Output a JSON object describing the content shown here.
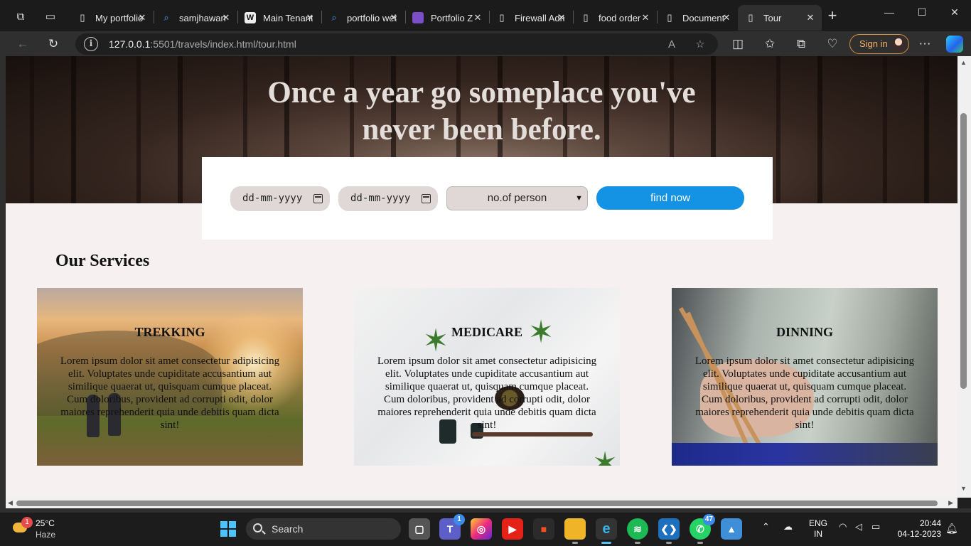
{
  "browser": {
    "tabs": [
      {
        "title": "My portfolio",
        "icon": "page-icon",
        "active": false
      },
      {
        "title": "samjhawan",
        "icon": "search-icon",
        "active": false
      },
      {
        "title": "Main Tenant",
        "icon": "logo-icon",
        "active": false
      },
      {
        "title": "portfolio website",
        "icon": "search-icon",
        "active": false
      },
      {
        "title": "Portfolio Z",
        "icon": "coloris-icon",
        "active": false
      },
      {
        "title": "Firewall Admin",
        "icon": "page-icon",
        "active": false
      },
      {
        "title": "food order",
        "icon": "page-icon",
        "active": false
      },
      {
        "title": "Document",
        "icon": "page-icon",
        "active": false
      },
      {
        "title": "Tour",
        "icon": "page-icon",
        "active": true
      }
    ],
    "address": {
      "host": "127.0.0.1",
      "path": ":5501/travels/index.html/tour.html"
    },
    "signin_label": "Sign in",
    "window": {
      "minimize": "—",
      "maximize": "☐",
      "close": "✕"
    }
  },
  "page": {
    "hero_title_line1": "Once a year go someplace you've",
    "hero_title_line2": "never been before.",
    "search": {
      "date_from_placeholder": "dd-mm-yyyy",
      "date_to_placeholder": "dd-mm-yyyy",
      "persons_selected": "no.of person",
      "find_label": "find now"
    },
    "services_title": "Our Services",
    "services": [
      {
        "title": "TREKKING",
        "text": "Lorem ipsum dolor sit amet consectetur adipisicing elit. Voluptates unde cupiditate accusantium aut similique quaerat ut, quisquam cumque placeat. Cum doloribus, provident ad corrupti odit, dolor maiores reprehenderit quia unde debitis quam dicta sint!"
      },
      {
        "title": "MEDICARE",
        "text": "Lorem ipsum dolor sit amet consectetur adipisicing elit. Voluptates unde cupiditate accusantium aut similique quaerat ut, quisquam cumque placeat. Cum doloribus, provident ad corrupti odit, dolor maiores reprehenderit quia unde debitis quam dicta sint!"
      },
      {
        "title": "DINNING",
        "text": "Lorem ipsum dolor sit amet consectetur adipisicing elit. Voluptates unde cupiditate accusantium aut similique quaerat ut, quisquam cumque placeat. Cum doloribus, provident ad corrupti odit, dolor maiores reprehenderit quia unde debitis quam dicta sint!"
      }
    ]
  },
  "taskbar": {
    "weather": {
      "temp": "25°C",
      "condition": "Haze",
      "badge": "1"
    },
    "search_label": "Search",
    "teams_badge": "1",
    "whatsapp_badge": "47",
    "language": {
      "line1": "ENG",
      "line2": "IN"
    },
    "time": "20:44",
    "date": "04-12-2023"
  },
  "colors": {
    "accent": "#1492e4",
    "page_bg": "#f6f1f0",
    "input_bg": "#e0d8d7"
  }
}
